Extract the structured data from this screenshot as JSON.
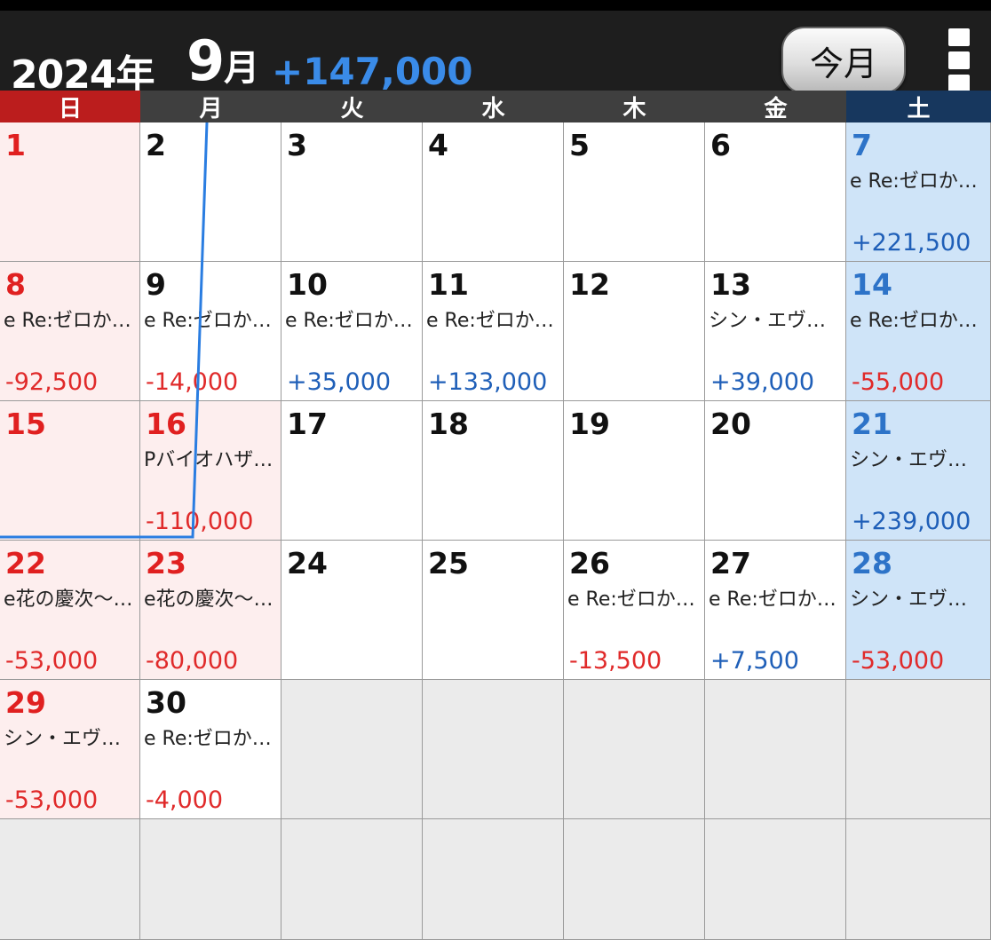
{
  "header": {
    "year": "2024年",
    "month_num": "9",
    "month_unit": "月",
    "total": "+147,000",
    "today_button": "今月",
    "menu_icon": "overflow-menu-icon"
  },
  "weekdays": [
    "日",
    "月",
    "火",
    "水",
    "木",
    "金",
    "土"
  ],
  "colors": {
    "sunday_header": "#bb1d1d",
    "saturday_header": "#17375e",
    "negative": "#e02a2a",
    "positive": "#1f5fb8",
    "total": "#3a8be8",
    "trend_line": "#2a7de1"
  },
  "cells": [
    {
      "day": "1",
      "kind": "sun",
      "title": "",
      "amount": "",
      "sign": ""
    },
    {
      "day": "2",
      "kind": "",
      "title": "",
      "amount": "",
      "sign": ""
    },
    {
      "day": "3",
      "kind": "",
      "title": "",
      "amount": "",
      "sign": ""
    },
    {
      "day": "4",
      "kind": "",
      "title": "",
      "amount": "",
      "sign": ""
    },
    {
      "day": "5",
      "kind": "",
      "title": "",
      "amount": "",
      "sign": ""
    },
    {
      "day": "6",
      "kind": "",
      "title": "",
      "amount": "",
      "sign": ""
    },
    {
      "day": "7",
      "kind": "sat",
      "title": "e Re:ゼロか…",
      "amount": "+221,500",
      "sign": "pos"
    },
    {
      "day": "8",
      "kind": "sun",
      "title": "e Re:ゼロか…",
      "amount": "-92,500",
      "sign": "neg"
    },
    {
      "day": "9",
      "kind": "",
      "title": "e Re:ゼロか…",
      "amount": "-14,000",
      "sign": "neg"
    },
    {
      "day": "10",
      "kind": "",
      "title": "e Re:ゼロか…",
      "amount": "+35,000",
      "sign": "pos"
    },
    {
      "day": "11",
      "kind": "",
      "title": "e Re:ゼロか…",
      "amount": "+133,000",
      "sign": "pos"
    },
    {
      "day": "12",
      "kind": "",
      "title": "",
      "amount": "",
      "sign": ""
    },
    {
      "day": "13",
      "kind": "",
      "title": "シン・エヴ…",
      "amount": "+39,000",
      "sign": "pos"
    },
    {
      "day": "14",
      "kind": "sat",
      "title": "e Re:ゼロか…",
      "amount": "-55,000",
      "sign": "neg"
    },
    {
      "day": "15",
      "kind": "sun",
      "title": "",
      "amount": "",
      "sign": ""
    },
    {
      "day": "16",
      "kind": "holiday",
      "title": "Pバイオハザ…",
      "amount": "-110,000",
      "sign": "neg"
    },
    {
      "day": "17",
      "kind": "",
      "title": "",
      "amount": "",
      "sign": ""
    },
    {
      "day": "18",
      "kind": "",
      "title": "",
      "amount": "",
      "sign": ""
    },
    {
      "day": "19",
      "kind": "",
      "title": "",
      "amount": "",
      "sign": ""
    },
    {
      "day": "20",
      "kind": "",
      "title": "",
      "amount": "",
      "sign": ""
    },
    {
      "day": "21",
      "kind": "sat",
      "title": "シン・エヴ…",
      "amount": "+239,000",
      "sign": "pos"
    },
    {
      "day": "22",
      "kind": "sun",
      "title": "e花の慶次～…",
      "amount": "-53,000",
      "sign": "neg"
    },
    {
      "day": "23",
      "kind": "holiday",
      "title": "e花の慶次～…",
      "amount": "-80,000",
      "sign": "neg"
    },
    {
      "day": "24",
      "kind": "",
      "title": "",
      "amount": "",
      "sign": ""
    },
    {
      "day": "25",
      "kind": "",
      "title": "",
      "amount": "",
      "sign": ""
    },
    {
      "day": "26",
      "kind": "",
      "title": "e Re:ゼロか…",
      "amount": "-13,500",
      "sign": "neg"
    },
    {
      "day": "27",
      "kind": "",
      "title": "e Re:ゼロか…",
      "amount": "+7,500",
      "sign": "pos"
    },
    {
      "day": "28",
      "kind": "sat",
      "title": "シン・エヴ…",
      "amount": "-53,000",
      "sign": "neg"
    },
    {
      "day": "29",
      "kind": "sun",
      "title": "シン・エヴ…",
      "amount": "-53,000",
      "sign": "neg"
    },
    {
      "day": "30",
      "kind": "",
      "title": "e Re:ゼロか…",
      "amount": "-4,000",
      "sign": "neg"
    },
    {
      "day": "",
      "kind": "empty",
      "title": "",
      "amount": "",
      "sign": ""
    },
    {
      "day": "",
      "kind": "empty",
      "title": "",
      "amount": "",
      "sign": ""
    },
    {
      "day": "",
      "kind": "empty",
      "title": "",
      "amount": "",
      "sign": ""
    },
    {
      "day": "",
      "kind": "empty",
      "title": "",
      "amount": "",
      "sign": ""
    },
    {
      "day": "",
      "kind": "empty",
      "title": "",
      "amount": "",
      "sign": ""
    },
    {
      "day": "",
      "kind": "empty",
      "title": "",
      "amount": "",
      "sign": ""
    },
    {
      "day": "",
      "kind": "empty",
      "title": "",
      "amount": "",
      "sign": ""
    },
    {
      "day": "",
      "kind": "empty",
      "title": "",
      "amount": "",
      "sign": ""
    },
    {
      "day": "",
      "kind": "empty",
      "title": "",
      "amount": "",
      "sign": ""
    },
    {
      "day": "",
      "kind": "empty",
      "title": "",
      "amount": "",
      "sign": ""
    },
    {
      "day": "",
      "kind": "empty",
      "title": "",
      "amount": "",
      "sign": ""
    },
    {
      "day": "",
      "kind": "empty",
      "title": "",
      "amount": "",
      "sign": ""
    }
  ]
}
